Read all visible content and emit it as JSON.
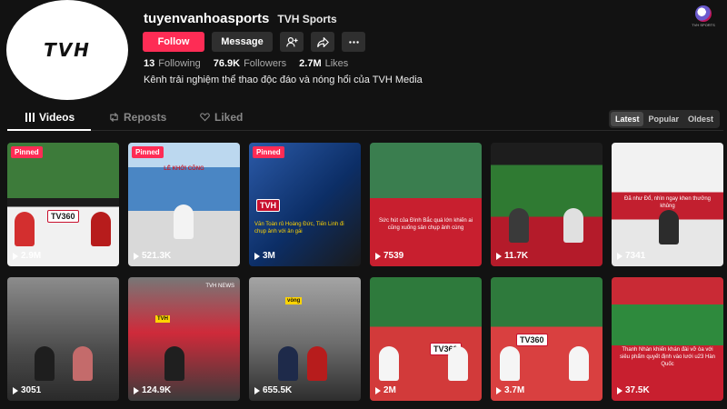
{
  "profile": {
    "avatar_logo": "TVH",
    "handle": "tuyenvanhoasports",
    "nickname": "TVH Sports",
    "bio": "Kênh trải nghiệm thể thao độc đáo và nóng hổi của TVH Media",
    "follow_label": "Follow",
    "message_label": "Message",
    "stats": [
      {
        "value": "13",
        "label": "Following"
      },
      {
        "value": "76.9K",
        "label": "Followers"
      },
      {
        "value": "2.7M",
        "label": "Likes"
      }
    ]
  },
  "icons": {
    "add_friend": "add-friend-icon",
    "share": "share-icon",
    "more": "more-icon"
  },
  "corner_logo_text": "TVH SPORTS",
  "tabs": [
    {
      "label": "Videos",
      "icon": "grid-icon",
      "active": true
    },
    {
      "label": "Reposts",
      "icon": "repost-icon",
      "active": false
    },
    {
      "label": "Liked",
      "icon": "heart-icon",
      "active": false
    }
  ],
  "sort": [
    "Latest",
    "Popular",
    "Oldest"
  ],
  "sort_active": "Latest",
  "pinned_label": "Pinned",
  "videos": [
    {
      "views": "2.9M",
      "pinned": true,
      "overlay": "TV360"
    },
    {
      "views": "521.3K",
      "pinned": true,
      "overlay": "LỄ KHỞI CÔNG"
    },
    {
      "views": "3M",
      "pinned": true,
      "overlay": "Văn Toàn rủ Hoàng Đức, Tiến Linh đi chụp ảnh với ân gái"
    },
    {
      "views": "7539",
      "pinned": false,
      "overlay": "Sức hút của Đình Bắc quá lớn khiến ai cũng xuống sân chụp ảnh cùng"
    },
    {
      "views": "11.7K",
      "pinned": false,
      "overlay": ""
    },
    {
      "views": "7341",
      "pinned": false,
      "overlay": "Đã như Đổ, nhìn ngay khen thưởng khủng"
    },
    {
      "views": "3051",
      "pinned": false,
      "overlay": ""
    },
    {
      "views": "124.9K",
      "pinned": false,
      "overlay": "TVH NEWS"
    },
    {
      "views": "655.5K",
      "pinned": false,
      "overlay": "vòng"
    },
    {
      "views": "2M",
      "pinned": false,
      "overlay": "TV360"
    },
    {
      "views": "3.7M",
      "pinned": false,
      "overlay": "TV360"
    },
    {
      "views": "37.5K",
      "pinned": false,
      "overlay": "Thanh Nhàn khiến khán đài vỡ òa với siêu phẩm quyết định vào lưới u23 Hàn Quốc"
    }
  ],
  "colors": {
    "accent": "#fe2c55",
    "background": "#121212"
  }
}
